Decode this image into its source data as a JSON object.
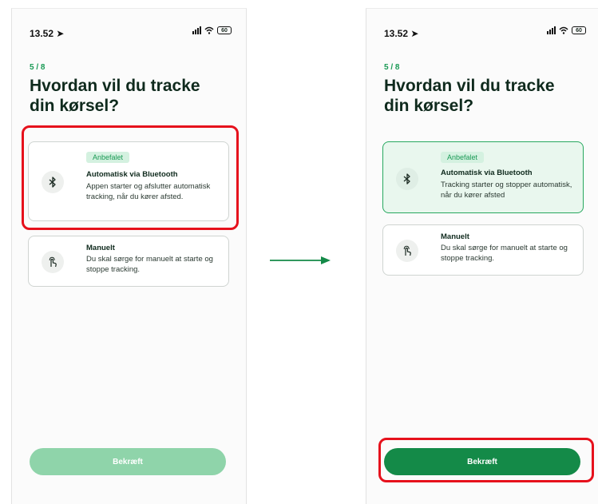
{
  "screens": {
    "before": {
      "status_time": "13.52",
      "battery": "60",
      "step": "5 / 8",
      "title": "Hvordan vil du tracke din kørsel?",
      "option_bluetooth": {
        "badge": "Anbefalet",
        "title": "Automatisk via Bluetooth",
        "desc": "Appen starter og afslutter automatisk tracking, når du kører afsted.",
        "icon": "bluetooth-icon",
        "selected": false
      },
      "option_manual": {
        "title": "Manuelt",
        "desc": "Du skal sørge for manuelt at starte og stoppe tracking.",
        "icon": "tap-hand-icon",
        "selected": false
      },
      "confirm_label": "Bekræft",
      "confirm_enabled": false
    },
    "after": {
      "status_time": "13.52",
      "battery": "60",
      "step": "5 / 8",
      "title": "Hvordan vil du tracke din kørsel?",
      "option_bluetooth": {
        "badge": "Anbefalet",
        "title": "Automatisk via Bluetooth",
        "desc": "Tracking starter og stopper automatisk, når du kører afsted",
        "icon": "bluetooth-icon",
        "selected": true
      },
      "option_manual": {
        "title": "Manuelt",
        "desc": "Du skal sørge for manuelt at starte og stoppe tracking.",
        "icon": "tap-hand-icon",
        "selected": false
      },
      "confirm_label": "Bekræft",
      "confirm_enabled": true
    }
  },
  "colors": {
    "accent_green": "#148a48",
    "disabled_green": "#8fd4aa",
    "selected_bg": "#e9f7ee",
    "highlight_red": "#e6111c",
    "step_green": "#1a9a55"
  }
}
